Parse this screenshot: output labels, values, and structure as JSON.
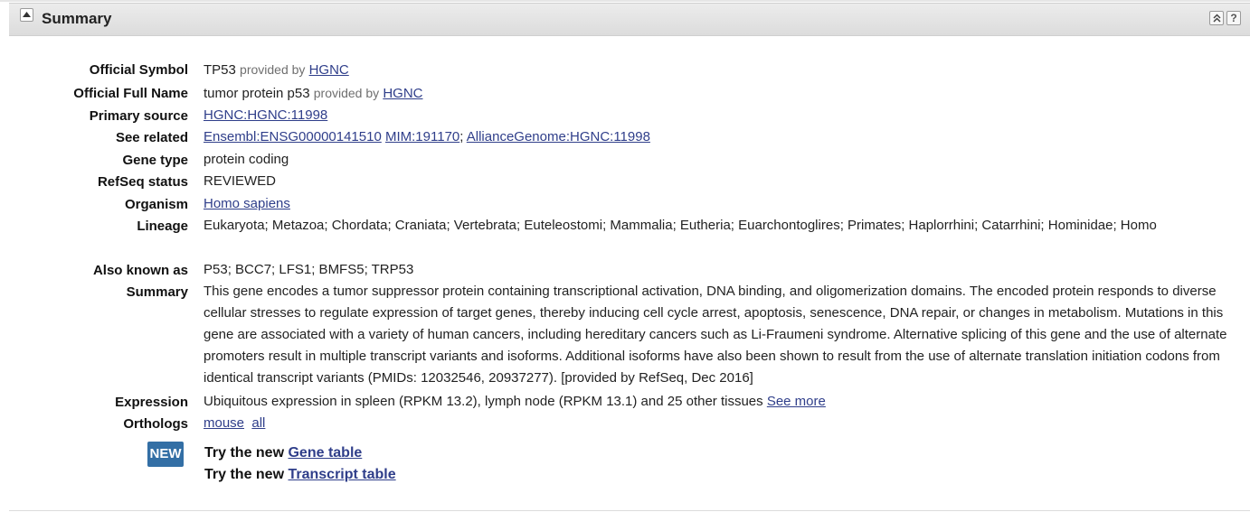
{
  "panel": {
    "title": "Summary"
  },
  "fields": {
    "official_symbol": {
      "label": "Official Symbol",
      "value": "TP53",
      "provided_by": "provided by",
      "provider": "HGNC"
    },
    "official_full_name": {
      "label": "Official Full Name",
      "value": "tumor protein p53",
      "provided_by": "provided by",
      "provider": "HGNC"
    },
    "primary_source": {
      "label": "Primary source",
      "link": "HGNC:HGNC:11998"
    },
    "see_related": {
      "label": "See related",
      "links": [
        "Ensembl:ENSG00000141510",
        "MIM:191170",
        "AllianceGenome:HGNC:11998"
      ],
      "separator": ";"
    },
    "gene_type": {
      "label": "Gene type",
      "value": "protein coding"
    },
    "refseq_status": {
      "label": "RefSeq status",
      "value": "REVIEWED"
    },
    "organism": {
      "label": "Organism",
      "link": "Homo sapiens"
    },
    "lineage": {
      "label": "Lineage",
      "value": "Eukaryota; Metazoa; Chordata; Craniata; Vertebrata; Euteleostomi; Mammalia; Eutheria; Euarchontoglires; Primates; Haplorrhini; Catarrhini; Hominidae; Homo"
    },
    "also_known_as": {
      "label": "Also known as",
      "value": "P53; BCC7; LFS1; BMFS5; TRP53"
    },
    "summary": {
      "label": "Summary",
      "value": "This gene encodes a tumor suppressor protein containing transcriptional activation, DNA binding, and oligomerization domains. The encoded protein responds to diverse cellular stresses to regulate expression of target genes, thereby inducing cell cycle arrest, apoptosis, senescence, DNA repair, or changes in metabolism. Mutations in this gene are associated with a variety of human cancers, including hereditary cancers such as Li-Fraumeni syndrome. Alternative splicing of this gene and the use of alternate promoters result in multiple transcript variants and isoforms. Additional isoforms have also been shown to result from the use of alternate translation initiation codons from identical transcript variants (PMIDs: 12032546, 20937277). [provided by RefSeq, Dec 2016]"
    },
    "expression": {
      "label": "Expression",
      "value": "Ubiquitous expression in spleen (RPKM 13.2), lymph node (RPKM 13.1) and 25 other tissues",
      "link": "See more"
    },
    "orthologs": {
      "label": "Orthologs",
      "links": [
        "mouse",
        "all"
      ]
    }
  },
  "promo": {
    "badge": "NEW",
    "prefix": "Try the new",
    "gene_table": "Gene table",
    "transcript_table": "Transcript table"
  },
  "colors": {
    "link": "#2f3e8a",
    "badge_bg": "#336fa5",
    "header_bg": "#dcdcdc"
  },
  "icons": {
    "collapse": "triangle-up-icon",
    "move_top": "double-chevron-up-icon",
    "help": "help-icon"
  }
}
